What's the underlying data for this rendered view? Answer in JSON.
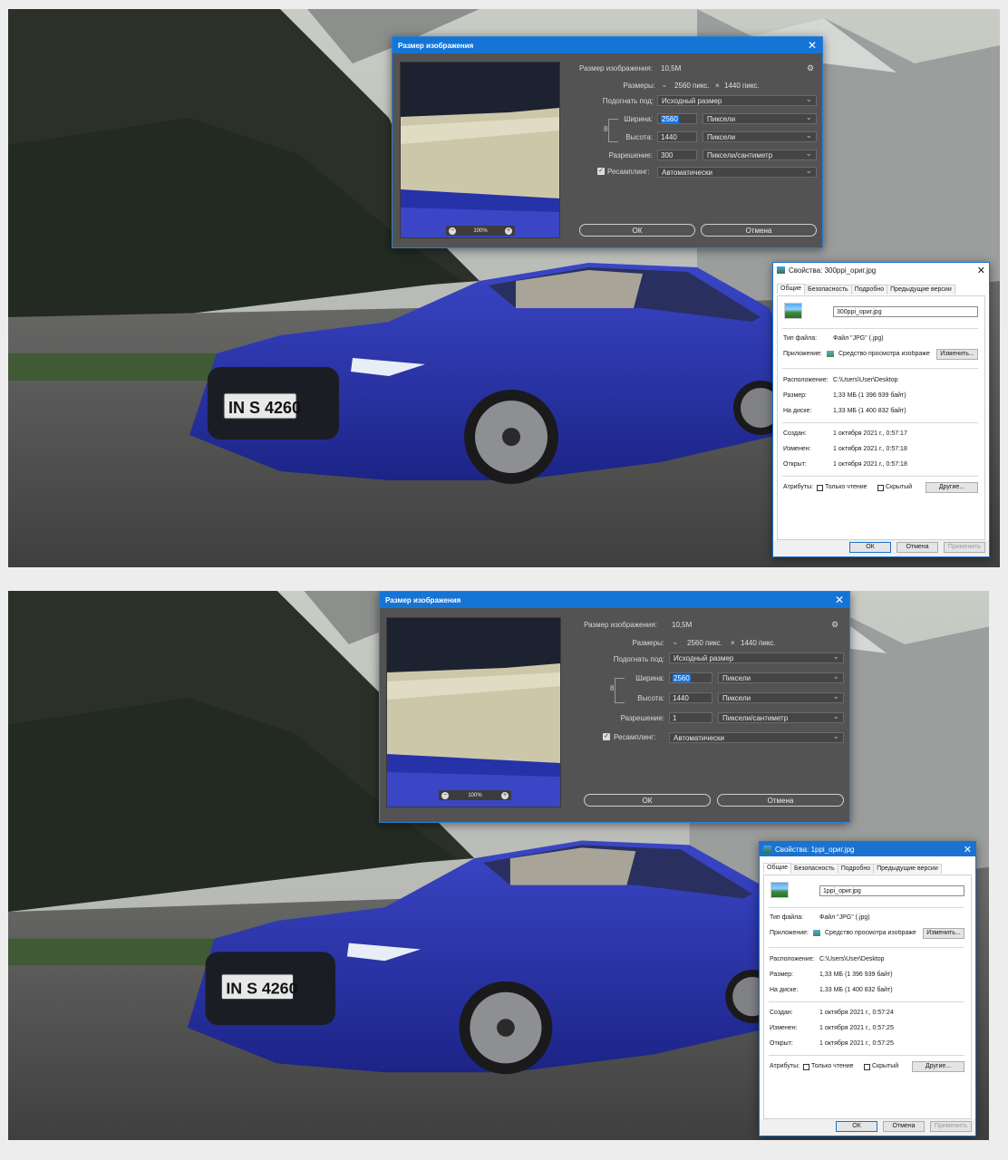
{
  "panels": [
    {
      "ps": {
        "title": "Размер изображения",
        "image_size_label": "Размер изображения:",
        "image_size_value": "10,5M",
        "dimensions_label": "Размеры:",
        "dimensions_width": "2560 пикс.",
        "dimensions_x": "×",
        "dimensions_height": "1440 пикс.",
        "fit_label": "Подогнать под:",
        "fit_value": "Исходный размер",
        "width_label": "Ширина:",
        "width_value": "2560",
        "width_unit": "Пиксели",
        "height_label": "Высота:",
        "height_value": "1440",
        "height_unit": "Пиксели",
        "resolution_label": "Разрешение:",
        "resolution_value": "300",
        "resolution_unit": "Пиксели/сантиметр",
        "resample_label": "Ресамплинг:",
        "resample_value": "Автоматически",
        "zoom": "100%",
        "ok": "ОК",
        "cancel": "Отмена"
      },
      "props": {
        "title": "Свойства: 300ppi_ориг.jpg",
        "tabs": [
          "Общие",
          "Безопасность",
          "Подробно",
          "Предыдущие версии"
        ],
        "filename": "300ppi_ориг.jpg",
        "type_label": "Тип файла:",
        "type_value": "Файл \"JPG\" (.jpg)",
        "app_label": "Приложение:",
        "app_value": "Средство просмотра изображе",
        "change_btn": "Изменить...",
        "location_label": "Расположение:",
        "location_value": "C:\\Users\\User\\Desktop",
        "size_label": "Размер:",
        "size_value": "1,33 МБ (1 396 939 байт)",
        "disk_label": "На диске:",
        "disk_value": "1,33 МБ (1 400 832 байт)",
        "created_label": "Создан:",
        "created_value": "1 октября 2021 г., 0:57:17",
        "modified_label": "Изменен:",
        "modified_value": "1 октября 2021 г., 0:57:18",
        "opened_label": "Открыт:",
        "opened_value": "1 октября 2021 г., 0:57:18",
        "attr_label": "Атрибуты:",
        "readonly_label": "Только чтение",
        "hidden_label": "Скрытый",
        "other_btn": "Другие...",
        "ok": "ОК",
        "cancel": "Отмена",
        "apply": "Применить"
      }
    },
    {
      "ps": {
        "title": "Размер изображения",
        "image_size_label": "Размер изображения:",
        "image_size_value": "10,5M",
        "dimensions_label": "Размеры:",
        "dimensions_width": "2560 пикс.",
        "dimensions_x": "×",
        "dimensions_height": "1440 пикс.",
        "fit_label": "Подогнать под:",
        "fit_value": "Исходный размер",
        "width_label": "Ширина:",
        "width_value": "2560",
        "width_unit": "Пиксели",
        "height_label": "Высота:",
        "height_value": "1440",
        "height_unit": "Пиксели",
        "resolution_label": "Разрешение:",
        "resolution_value": "1",
        "resolution_unit": "Пиксели/сантиметр",
        "resample_label": "Ресамплинг:",
        "resample_value": "Автоматически",
        "zoom": "100%",
        "ok": "ОК",
        "cancel": "Отмена"
      },
      "props": {
        "title": "Свойства: 1ppi_ориг.jpg",
        "tabs": [
          "Общие",
          "Безопасность",
          "Подробно",
          "Предыдущие версии"
        ],
        "filename": "1ppi_ориг.jpg",
        "type_label": "Тип файла:",
        "type_value": "Файл \"JPG\" (.jpg)",
        "app_label": "Приложение:",
        "app_value": "Средство просмотра изображе",
        "change_btn": "Изменить...",
        "location_label": "Расположение:",
        "location_value": "C:\\Users\\User\\Desktop",
        "size_label": "Размер:",
        "size_value": "1,33 МБ (1 396 939 байт)",
        "disk_label": "На диске:",
        "disk_value": "1,33 МБ (1 400 832 байт)",
        "created_label": "Создан:",
        "created_value": "1 октября 2021 г., 0:57:24",
        "modified_label": "Изменен:",
        "modified_value": "1 октября 2021 г., 0:57:25",
        "opened_label": "Открыт:",
        "opened_value": "1 октября 2021 г., 0:57:25",
        "attr_label": "Атрибуты:",
        "readonly_label": "Только чтение",
        "hidden_label": "Скрытый",
        "other_btn": "Другие...",
        "ok": "ОК",
        "cancel": "Отмена",
        "apply": "Применить"
      }
    }
  ],
  "license_plate": "IN S 4260"
}
